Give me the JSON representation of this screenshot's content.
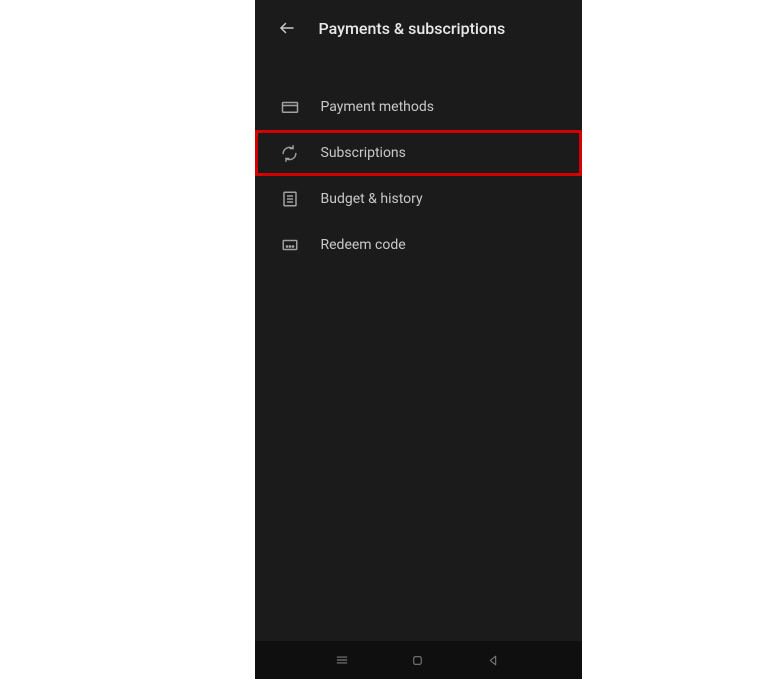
{
  "header": {
    "title": "Payments & subscriptions"
  },
  "menu": {
    "items": [
      {
        "icon": "card-icon",
        "label": "Payment methods"
      },
      {
        "icon": "refresh-icon",
        "label": "Subscriptions"
      },
      {
        "icon": "list-icon",
        "label": "Budget & history"
      },
      {
        "icon": "code-icon",
        "label": "Redeem code"
      }
    ],
    "highlighted_index": 1
  }
}
